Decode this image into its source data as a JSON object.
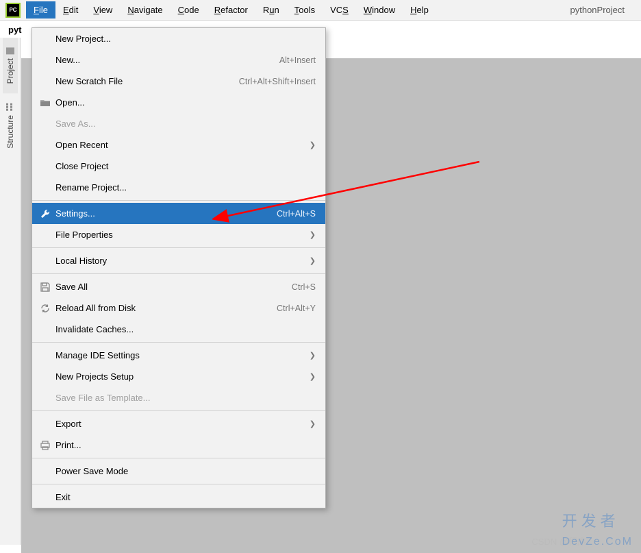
{
  "menubar": {
    "items": [
      {
        "label": "File",
        "u": "F"
      },
      {
        "label": "Edit",
        "u": "E"
      },
      {
        "label": "View",
        "u": "V"
      },
      {
        "label": "Navigate",
        "u": "N"
      },
      {
        "label": "Code",
        "u": "C"
      },
      {
        "label": "Refactor",
        "u": "R"
      },
      {
        "label": "Run",
        "u": "u"
      },
      {
        "label": "Tools",
        "u": "T"
      },
      {
        "label": "VCS",
        "u": "S"
      },
      {
        "label": "Window",
        "u": "W"
      },
      {
        "label": "Help",
        "u": "H"
      }
    ],
    "project": "pythonProject"
  },
  "crumb": "pyt",
  "sidebar": {
    "project": "Project",
    "structure": "Structure"
  },
  "dropdown": [
    {
      "type": "item",
      "label": "New Project..."
    },
    {
      "type": "item",
      "label": "New...",
      "u": "N",
      "shortcut": "Alt+Insert"
    },
    {
      "type": "item",
      "label": "New Scratch File",
      "shortcut": "Ctrl+Alt+Shift+Insert"
    },
    {
      "type": "item",
      "label": "Open...",
      "u": "O",
      "icon": "folder"
    },
    {
      "type": "item",
      "label": "Save As...",
      "disabled": true
    },
    {
      "type": "item",
      "label": "Open Recent",
      "submenu": true
    },
    {
      "type": "item",
      "label": "Close Project"
    },
    {
      "type": "item",
      "label": "Rename Project..."
    },
    {
      "type": "sep"
    },
    {
      "type": "item",
      "label": "Settings...",
      "shortcut": "Ctrl+Alt+S",
      "icon": "wrench",
      "highlight": true
    },
    {
      "type": "item",
      "label": "File Properties",
      "submenu": true
    },
    {
      "type": "sep"
    },
    {
      "type": "item",
      "label": "Local History",
      "u": "H",
      "submenu": true
    },
    {
      "type": "sep"
    },
    {
      "type": "item",
      "label": "Save All",
      "u": "S",
      "shortcut": "Ctrl+S",
      "icon": "save"
    },
    {
      "type": "item",
      "label": "Reload All from Disk",
      "shortcut": "Ctrl+Alt+Y",
      "icon": "reload"
    },
    {
      "type": "item",
      "label": "Invalidate Caches..."
    },
    {
      "type": "sep"
    },
    {
      "type": "item",
      "label": "Manage IDE Settings",
      "submenu": true
    },
    {
      "type": "item",
      "label": "New Projects Setup",
      "submenu": true
    },
    {
      "type": "item",
      "label": "Save File as Template...",
      "u": "l",
      "disabled": true
    },
    {
      "type": "sep"
    },
    {
      "type": "item",
      "label": "Export",
      "submenu": true
    },
    {
      "type": "item",
      "label": "Print...",
      "u": "P",
      "icon": "printer"
    },
    {
      "type": "sep"
    },
    {
      "type": "item",
      "label": "Power Save Mode"
    },
    {
      "type": "sep"
    },
    {
      "type": "item",
      "label": "Exit",
      "u": "x"
    }
  ],
  "watermark": {
    "main": "开发者",
    "sub": "DevZe.CoM",
    "csdn": "CSDN @程序"
  }
}
